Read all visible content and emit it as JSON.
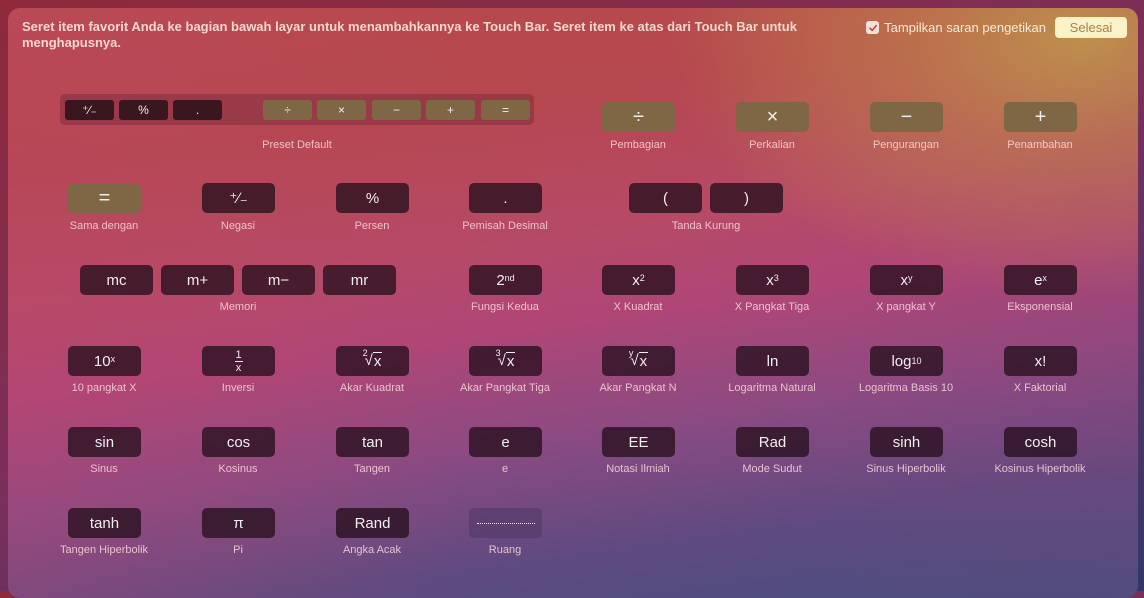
{
  "header": {
    "instruction": "Seret item favorit Anda ke bagian bawah layar untuk menambahkannya ke Touch Bar. Seret item ke atas dari Touch Bar untuk menghapusnya.",
    "checkbox_label": "Tampilkan saran pengetikan",
    "checkbox_checked": true,
    "done_label": "Selesai"
  },
  "preset": {
    "label": "Preset Default",
    "keys": [
      "⁺∕₋",
      "%",
      ".",
      "÷",
      "×",
      "−",
      "+",
      "="
    ]
  },
  "items": {
    "divide": {
      "key": "÷",
      "label": "Pembagian"
    },
    "multiply": {
      "key": "×",
      "label": "Perkalian"
    },
    "subtract": {
      "key": "−",
      "label": "Pengurangan"
    },
    "add": {
      "key": "+",
      "label": "Penambahan"
    },
    "equals": {
      "key": "=",
      "label": "Sama dengan"
    },
    "negate": {
      "key": "⁺∕₋",
      "label": "Negasi"
    },
    "percent": {
      "key": "%",
      "label": "Persen"
    },
    "decimal": {
      "key": ".",
      "label": "Pemisah Desimal"
    },
    "parens": {
      "open": "(",
      "close": ")",
      "label": "Tanda Kurung"
    },
    "memory": {
      "keys": [
        "mc",
        "m+",
        "m−",
        "mr"
      ],
      "label": "Memori"
    },
    "second": {
      "base": "2",
      "sup": "nd",
      "label": "Fungsi Kedua"
    },
    "square": {
      "base": "x",
      "sup": "2",
      "label": "X Kuadrat"
    },
    "cube": {
      "base": "x",
      "sup": "3",
      "label": "X Pangkat Tiga"
    },
    "power_y": {
      "base": "x",
      "sup": "y",
      "label": "X pangkat Y"
    },
    "exp": {
      "base": "e",
      "sup": "x",
      "label": "Eksponensial"
    },
    "ten_x": {
      "base": "10",
      "sup": "x",
      "label": "10 pangkat X"
    },
    "inverse": {
      "num": "1",
      "den": "x",
      "label": "Inversi"
    },
    "sqrt": {
      "idx": "2",
      "rad": "x",
      "label": "Akar Kuadrat"
    },
    "cbrt": {
      "idx": "3",
      "rad": "x",
      "label": "Akar Pangkat Tiga"
    },
    "nroot": {
      "idx": "y",
      "rad": "x",
      "label": "Akar Pangkat N"
    },
    "ln": {
      "key": "ln",
      "label": "Logaritma Natural"
    },
    "log10": {
      "base": "log",
      "sub": "10",
      "label": "Logaritma Basis 10"
    },
    "fact": {
      "key": "x!",
      "label": "X Faktorial"
    },
    "sin": {
      "key": "sin",
      "label": "Sinus"
    },
    "cos": {
      "key": "cos",
      "label": "Kosinus"
    },
    "tan": {
      "key": "tan",
      "label": "Tangen"
    },
    "e": {
      "key": "e",
      "label": "e"
    },
    "ee": {
      "key": "EE",
      "label": "Notasi Ilmiah"
    },
    "rad": {
      "key": "Rad",
      "label": "Mode Sudut"
    },
    "sinh": {
      "key": "sinh",
      "label": "Sinus Hiperbolik"
    },
    "cosh": {
      "key": "cosh",
      "label": "Kosinus Hiperbolik"
    },
    "tanh": {
      "key": "tanh",
      "label": "Tangen Hiperbolik"
    },
    "pi": {
      "key": "π",
      "label": "Pi"
    },
    "rand": {
      "key": "Rand",
      "label": "Angka Acak"
    },
    "space": {
      "label": "Ruang"
    }
  }
}
